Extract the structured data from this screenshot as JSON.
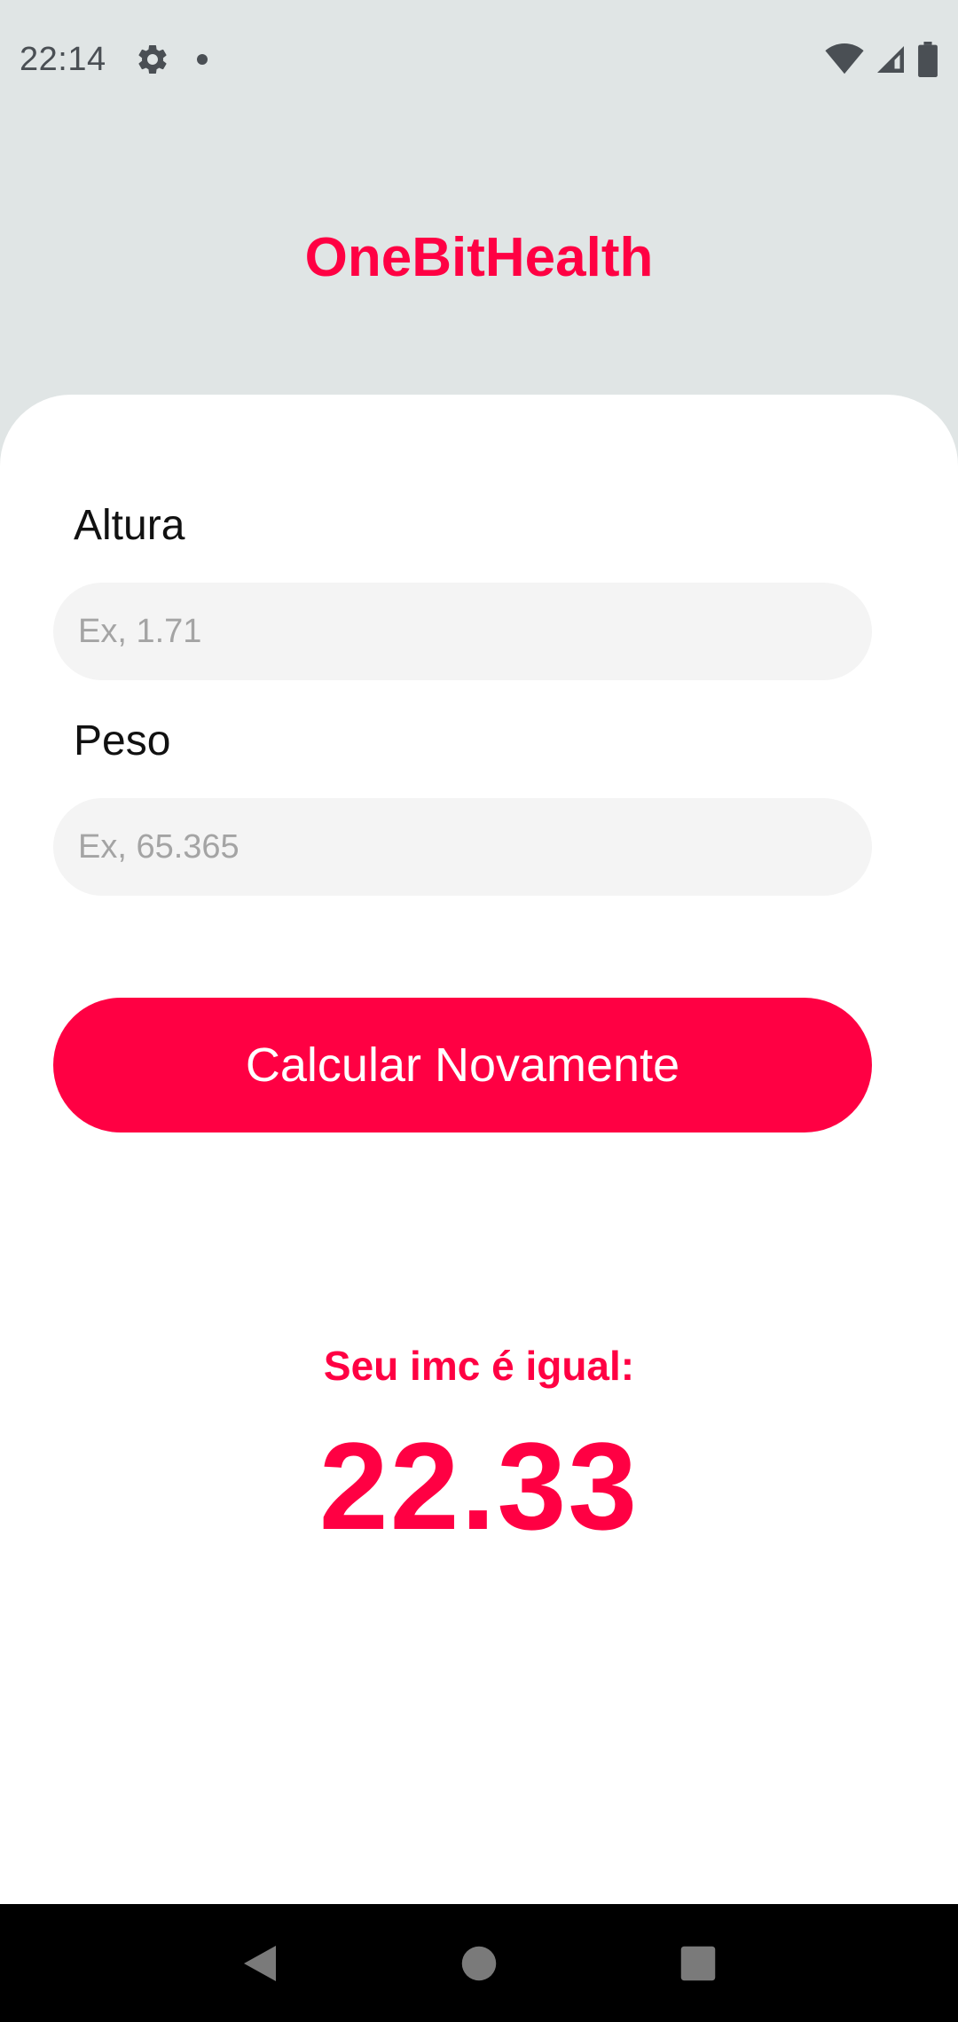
{
  "status_bar": {
    "time": "22:14",
    "icons": [
      "settings-icon",
      "notification-dot-icon",
      "wifi-icon",
      "signal-icon",
      "battery-icon"
    ]
  },
  "header": {
    "title": "OneBitHealth"
  },
  "form": {
    "height_label": "Altura",
    "height_placeholder": "Ex, 1.71",
    "height_value": "",
    "weight_label": "Peso",
    "weight_placeholder": "Ex, 65.365",
    "weight_value": "",
    "calculate_button_label": "Calcular Novamente"
  },
  "result": {
    "label": "Seu imc é igual:",
    "value": "22.33"
  },
  "navigation": {
    "buttons": [
      "back-icon",
      "home-icon",
      "recents-icon"
    ]
  },
  "colors": {
    "accent": "#ff0043",
    "header_background": "#e0e5e5",
    "card_background": "#ffffff",
    "input_background": "#f4f4f4",
    "nav_background": "#000000"
  }
}
